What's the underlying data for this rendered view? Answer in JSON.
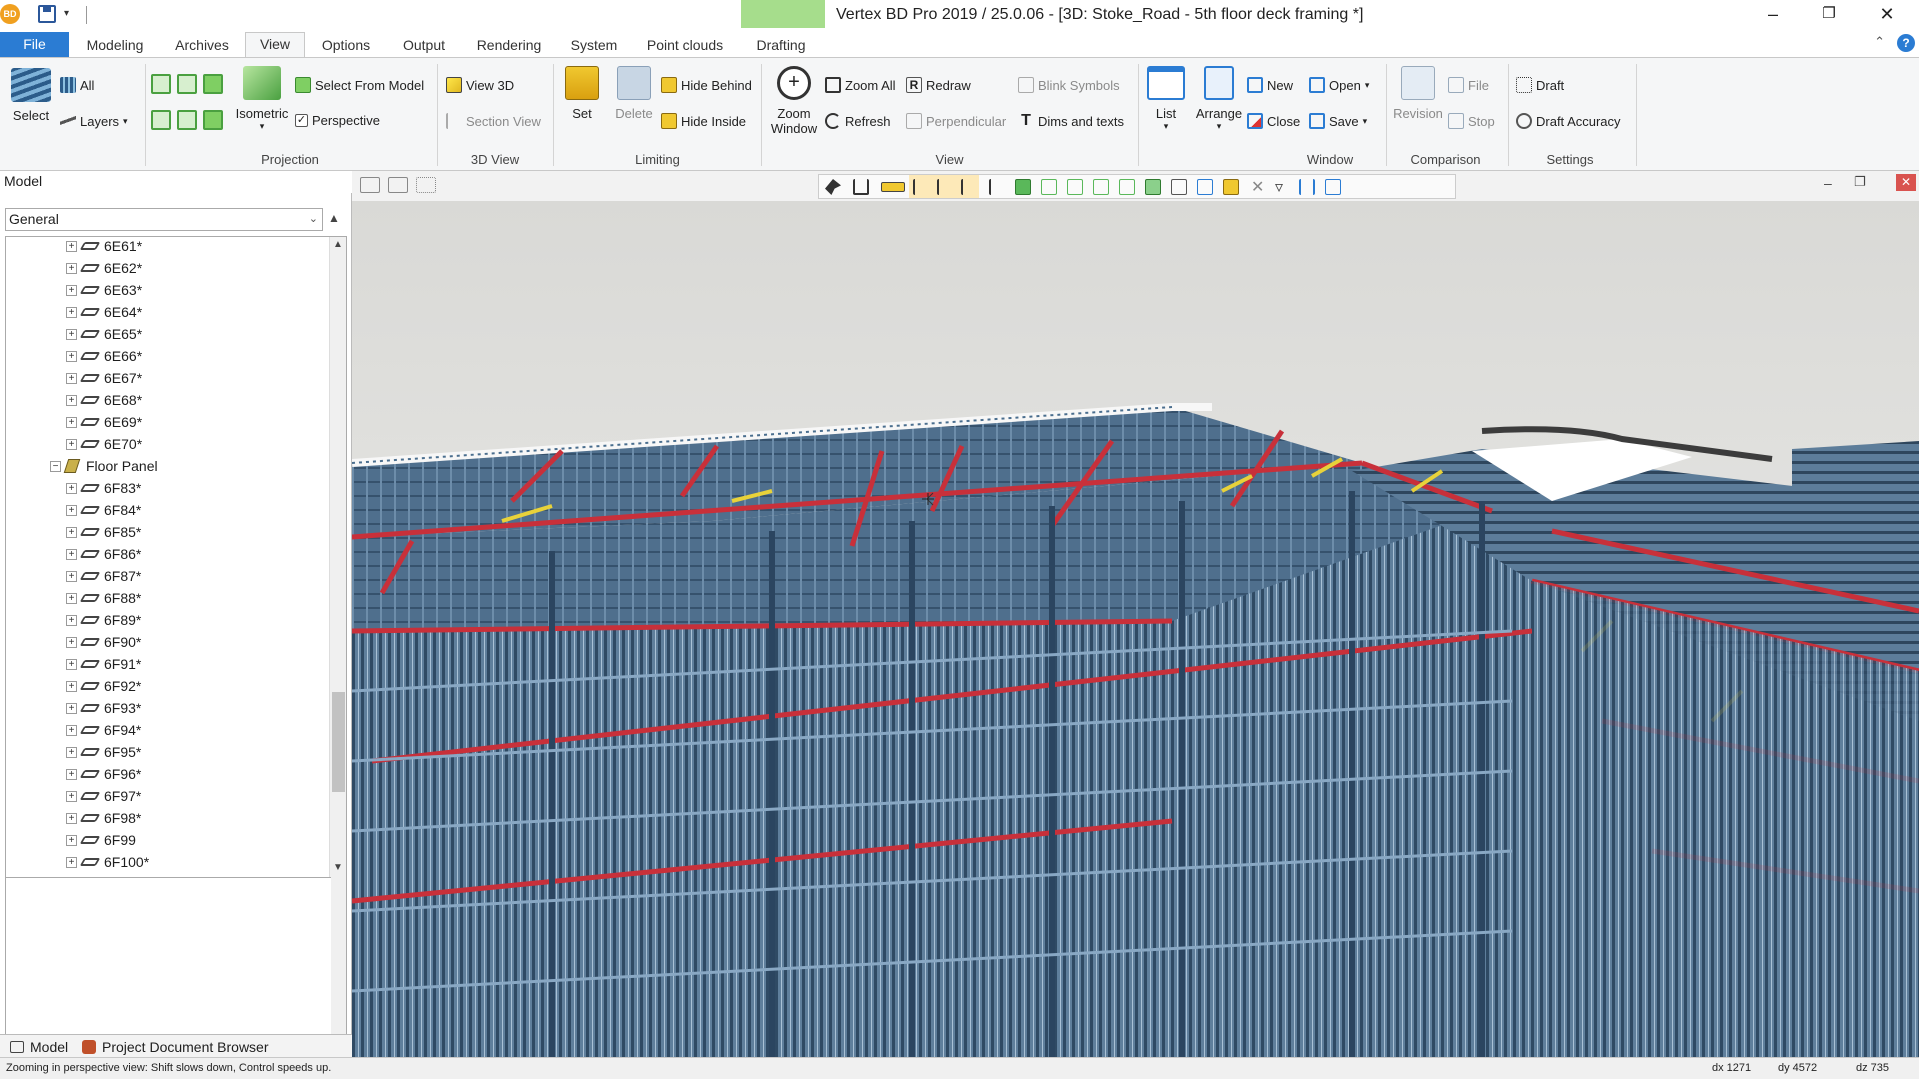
{
  "titlebar": {
    "app_icon": "BD",
    "title": "Vertex BD Pro 2019 / 25.0.06 - [3D: Stoke_Road - 5th floor deck framing *]"
  },
  "tabs": [
    "File",
    "Modeling",
    "Archives",
    "View",
    "Options",
    "Output",
    "Rendering",
    "System",
    "Point clouds",
    "Drafting"
  ],
  "active_tab": "View",
  "ribbon": {
    "select": {
      "label": "Select",
      "all": "All",
      "layers": "Layers"
    },
    "projection": {
      "label": "Projection",
      "isometric": "Isometric",
      "select_from_model": "Select From Model",
      "perspective": "Perspective"
    },
    "view3d": {
      "label": "3D View",
      "view_3d": "View 3D",
      "section_view": "Section View"
    },
    "limiting": {
      "label": "Limiting",
      "set": "Set",
      "delete": "Delete",
      "hide_behind": "Hide Behind",
      "hide_inside": "Hide Inside"
    },
    "view": {
      "label": "View",
      "zoom_window": "Zoom Window",
      "zoom_all": "Zoom All",
      "refresh": "Refresh",
      "redraw": "Redraw",
      "perpendicular": "Perpendicular",
      "blink_symbols": "Blink Symbols",
      "dims_texts": "Dims and texts"
    },
    "window": {
      "label": "Window",
      "list": "List",
      "arrange": "Arrange",
      "new": "New",
      "close": "Close",
      "open": "Open",
      "save": "Save"
    },
    "comparison": {
      "label": "Comparison",
      "revision": "Revision",
      "file": "File",
      "stop": "Stop"
    },
    "settings": {
      "label": "Settings",
      "draft": "Draft",
      "draft_accuracy": "Draft Accuracy"
    }
  },
  "model_panel": {
    "title": "Model",
    "filter": "General",
    "tree": [
      {
        "label": "6E61*",
        "level": 2
      },
      {
        "label": "6E62*",
        "level": 2
      },
      {
        "label": "6E63*",
        "level": 2
      },
      {
        "label": "6E64*",
        "level": 2
      },
      {
        "label": "6E65*",
        "level": 2
      },
      {
        "label": "6E66*",
        "level": 2
      },
      {
        "label": "6E67*",
        "level": 2
      },
      {
        "label": "6E68*",
        "level": 2
      },
      {
        "label": "6E69*",
        "level": 2
      },
      {
        "label": "6E70*",
        "level": 2
      },
      {
        "label": "Floor Panel",
        "level": 1
      },
      {
        "label": "6F83*",
        "level": 2
      },
      {
        "label": "6F84*",
        "level": 2
      },
      {
        "label": "6F85*",
        "level": 2
      },
      {
        "label": "6F86*",
        "level": 2
      },
      {
        "label": "6F87*",
        "level": 2
      },
      {
        "label": "6F88*",
        "level": 2
      },
      {
        "label": "6F89*",
        "level": 2
      },
      {
        "label": "6F90*",
        "level": 2
      },
      {
        "label": "6F91*",
        "level": 2
      },
      {
        "label": "6F92*",
        "level": 2
      },
      {
        "label": "6F93*",
        "level": 2
      },
      {
        "label": "6F94*",
        "level": 2
      },
      {
        "label": "6F95*",
        "level": 2
      },
      {
        "label": "6F96*",
        "level": 2
      },
      {
        "label": "6F97*",
        "level": 2
      },
      {
        "label": "6F98*",
        "level": 2
      },
      {
        "label": "6F99",
        "level": 2
      },
      {
        "label": "6F100*",
        "level": 2
      }
    ],
    "bottom_tabs": [
      "Model",
      "Project Document Browser"
    ]
  },
  "status": {
    "message": "Zooming in perspective view: Shift slows down, Control speeds up.",
    "dx": "dx 1271",
    "dy": "dy 4572",
    "dz": "dz 735"
  },
  "colors": {
    "accent": "#2b7cd3",
    "beam_red": "#c8303a",
    "beam_blue": "#4a6e8e",
    "brace_yellow": "#e8d23a",
    "sky": "#e4e4e2"
  }
}
